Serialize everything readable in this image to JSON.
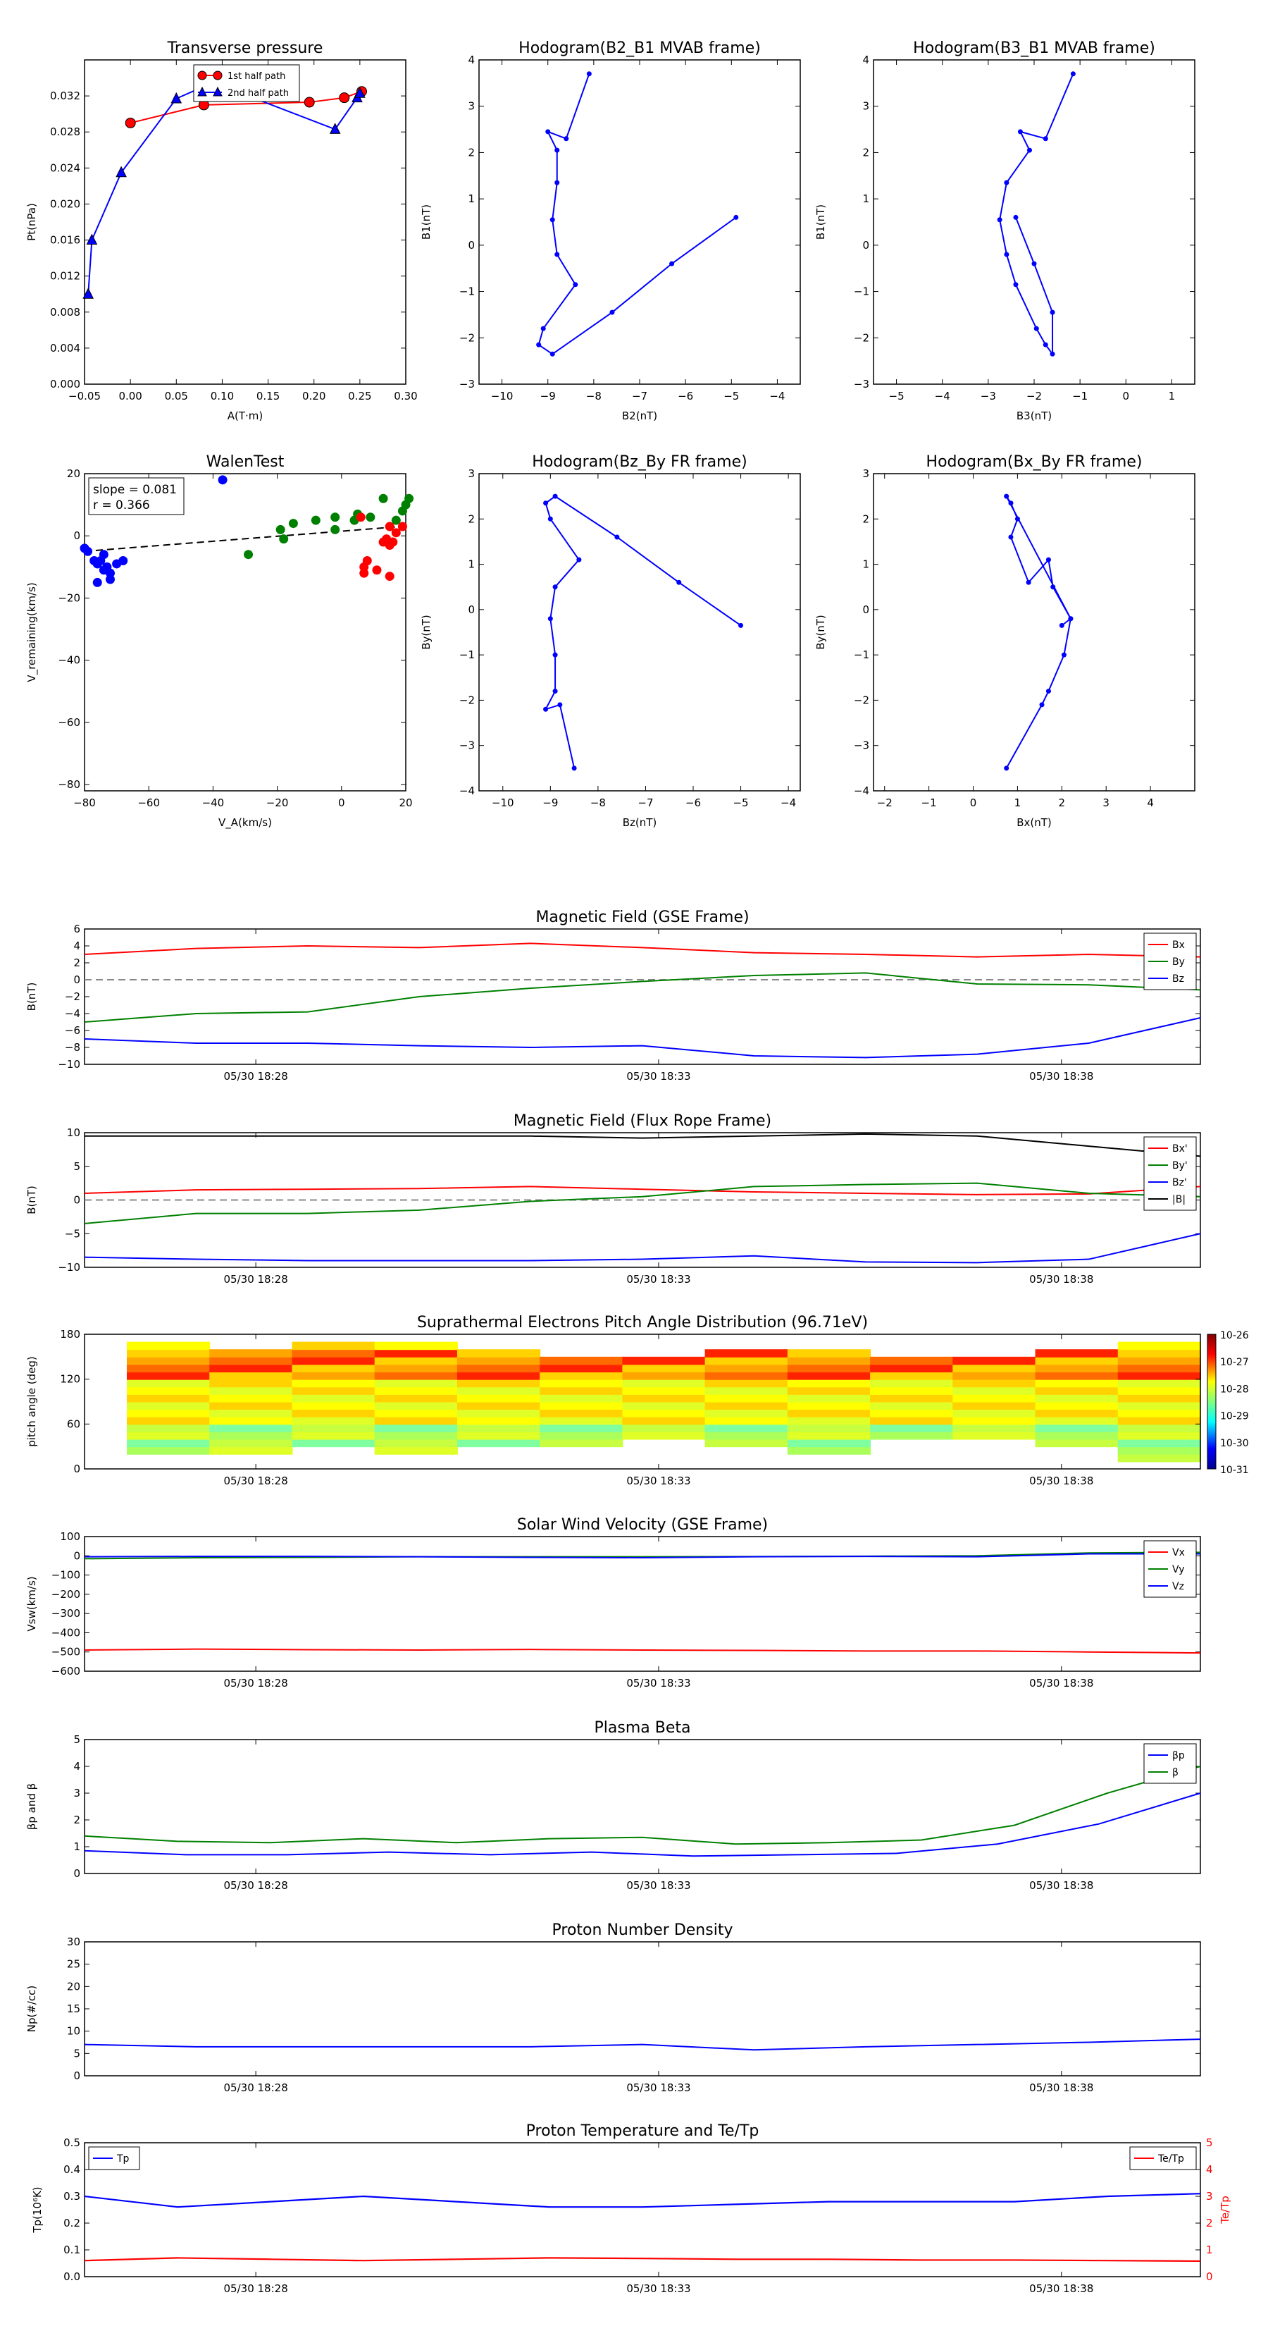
{
  "x_ticks_time": [
    "05/30 18:28",
    "05/30 18:33",
    "05/30 18:38"
  ],
  "chart_data": [
    {
      "id": "transverse-pressure",
      "type": "line",
      "title": "Transverse pressure",
      "xlabel": "A(T·m)",
      "ylabel": "Pt(nPa)",
      "xlim": [
        -0.05,
        0.3
      ],
      "ylim": [
        0.0,
        0.036
      ],
      "xticks": [
        -0.05,
        0.0,
        0.05,
        0.1,
        0.15,
        0.2,
        0.25,
        0.3
      ],
      "xtick_labels": [
        "−0.05",
        "0.00",
        "0.05",
        "0.10",
        "0.15",
        "0.20",
        "0.25",
        "0.30"
      ],
      "yticks": [
        0.0,
        0.004,
        0.008,
        0.012,
        0.016,
        0.02,
        0.024,
        0.028,
        0.032
      ],
      "ytick_labels": [
        "0.000",
        "0.004",
        "0.008",
        "0.012",
        "0.016",
        "0.020",
        "0.024",
        "0.028",
        "0.032"
      ],
      "legend": "top-center",
      "series": [
        {
          "name": "1st half path",
          "color": "#ff0000",
          "marker": "circle",
          "x": [
            0.0,
            0.08,
            0.195,
            0.233,
            0.252
          ],
          "y": [
            0.029,
            0.031,
            0.0313,
            0.0318,
            0.0325
          ]
        },
        {
          "name": "2nd half path",
          "color": "#0000ff",
          "marker": "triangle",
          "x": [
            -0.046,
            -0.042,
            -0.01,
            0.05,
            0.09,
            0.223,
            0.247,
            0.25
          ],
          "y": [
            0.01,
            0.016,
            0.0235,
            0.0317,
            0.0335,
            0.0283,
            0.0318,
            0.0323
          ]
        }
      ]
    },
    {
      "id": "hodogram-b2-b1",
      "type": "line",
      "title": "Hodogram(B2_B1 MVAB frame)",
      "xlabel": "B2(nT)",
      "ylabel": "B1(nT)",
      "xlim": [
        -10.5,
        -3.5
      ],
      "ylim": [
        -3,
        4
      ],
      "xticks": [
        -10,
        -9,
        -8,
        -7,
        -6,
        -5,
        -4
      ],
      "xtick_labels": [
        "−10",
        "−9",
        "−8",
        "−7",
        "−6",
        "−5",
        "−4"
      ],
      "yticks": [
        -3,
        -2,
        -1,
        0,
        1,
        2,
        3,
        4
      ],
      "ytick_labels": [
        "−3",
        "−2",
        "−1",
        "0",
        "1",
        "2",
        "3",
        "4"
      ],
      "series": [
        {
          "color": "#0000ff",
          "x": [
            -4.9,
            -6.3,
            -7.6,
            -8.9,
            -9.2,
            -9.1,
            -8.4,
            -8.8,
            -8.9,
            -8.8,
            -8.8,
            -9.0,
            -8.6,
            -8.1
          ],
          "y": [
            0.6,
            -0.4,
            -1.45,
            -2.35,
            -2.15,
            -1.8,
            -0.85,
            -0.2,
            0.55,
            1.35,
            2.05,
            2.45,
            2.3,
            3.7
          ]
        }
      ]
    },
    {
      "id": "hodogram-b3-b1",
      "type": "line",
      "title": "Hodogram(B3_B1 MVAB frame)",
      "xlabel": "B3(nT)",
      "ylabel": "B1(nT)",
      "xlim": [
        -5.5,
        1.5
      ],
      "ylim": [
        -3,
        4
      ],
      "xticks": [
        -5,
        -4,
        -3,
        -2,
        -1,
        0,
        1
      ],
      "xtick_labels": [
        "−5",
        "−4",
        "−3",
        "−2",
        "−1",
        "0",
        "1"
      ],
      "yticks": [
        -3,
        -2,
        -1,
        0,
        1,
        2,
        3,
        4
      ],
      "ytick_labels": [
        "−3",
        "−2",
        "−1",
        "0",
        "1",
        "2",
        "3",
        "4"
      ],
      "series": [
        {
          "color": "#0000ff",
          "x": [
            -2.4,
            -2.0,
            -1.6,
            -1.6,
            -1.75,
            -1.95,
            -2.4,
            -2.6,
            -2.75,
            -2.6,
            -2.1,
            -2.3,
            -1.75,
            -1.15
          ],
          "y": [
            0.6,
            -0.4,
            -1.45,
            -2.35,
            -2.15,
            -1.8,
            -0.85,
            -0.2,
            0.55,
            1.35,
            2.05,
            2.45,
            2.3,
            3.7
          ]
        }
      ]
    },
    {
      "id": "walen-test",
      "type": "scatter",
      "title": "WalenTest",
      "xlabel": "V_A(km/s)",
      "ylabel": "V_remaining(km/s)",
      "xlim": [
        -80,
        20
      ],
      "ylim": [
        -82,
        20
      ],
      "xticks": [
        -80,
        -60,
        -40,
        -20,
        0,
        20
      ],
      "xtick_labels": [
        "−80",
        "−60",
        "−40",
        "−20",
        "0",
        "20"
      ],
      "yticks": [
        -80,
        -60,
        -40,
        -20,
        0,
        20
      ],
      "ytick_labels": [
        "−80",
        "−60",
        "−40",
        "−20",
        "0",
        "20"
      ],
      "annotation": [
        "slope = 0.081",
        "r = 0.366"
      ],
      "fit": {
        "slope": 0.081,
        "intercept": 1.5,
        "color": "#000000",
        "style": "dashed"
      },
      "series": [
        {
          "color": "#0000ff",
          "x": [
            -80,
            -79,
            -76,
            -75,
            -74,
            -73,
            -72,
            -70,
            -68,
            -76,
            -74,
            -72,
            -77,
            -37
          ],
          "y": [
            -4,
            -5,
            -9,
            -8,
            -6,
            -10,
            -12,
            -9,
            -8,
            -15,
            -11,
            -14,
            -8,
            18
          ]
        },
        {
          "color": "#008000",
          "x": [
            -29,
            -19,
            -18,
            -15,
            -8,
            -2,
            -2,
            4,
            5,
            9,
            13,
            17,
            19,
            20,
            21
          ],
          "y": [
            -6,
            2,
            -1,
            4,
            5,
            6,
            2,
            5,
            7,
            6,
            12,
            5,
            8,
            10,
            12
          ]
        },
        {
          "color": "#ff0000",
          "x": [
            6,
            7,
            7,
            8,
            11,
            13,
            14,
            15,
            15,
            16,
            17,
            19,
            15
          ],
          "y": [
            6,
            -12,
            -10,
            -8,
            -11,
            -2,
            -1,
            3,
            -3,
            -2,
            1,
            3,
            -13
          ]
        }
      ]
    },
    {
      "id": "hodogram-bz-by",
      "type": "line",
      "title": "Hodogram(Bz_By FR frame)",
      "xlabel": "Bz(nT)",
      "ylabel": "By(nT)",
      "xlim": [
        -10.5,
        -3.75
      ],
      "ylim": [
        -4,
        3
      ],
      "xticks": [
        -10,
        -9,
        -8,
        -7,
        -6,
        -5,
        -4
      ],
      "xtick_labels": [
        "−10",
        "−9",
        "−8",
        "−7",
        "−6",
        "−5",
        "−4"
      ],
      "yticks": [
        -4,
        -3,
        -2,
        -1,
        0,
        1,
        2,
        3
      ],
      "ytick_labels": [
        "−4",
        "−3",
        "−2",
        "−1",
        "0",
        "1",
        "2",
        "3"
      ],
      "series": [
        {
          "color": "#0000ff",
          "x": [
            -5.0,
            -6.3,
            -7.6,
            -8.9,
            -9.1,
            -9.0,
            -8.4,
            -8.9,
            -9.0,
            -8.9,
            -8.9,
            -9.1,
            -8.8,
            -8.5
          ],
          "y": [
            -0.35,
            0.6,
            1.6,
            2.5,
            2.35,
            2.0,
            1.1,
            0.5,
            -0.2,
            -1.0,
            -1.8,
            -2.2,
            -2.1,
            -3.5
          ]
        }
      ]
    },
    {
      "id": "hodogram-bx-by",
      "type": "line",
      "title": "Hodogram(Bx_By FR frame)",
      "xlabel": "Bx(nT)",
      "ylabel": "By(nT)",
      "xlim": [
        -2.25,
        5.0
      ],
      "ylim": [
        -4,
        3
      ],
      "xticks": [
        -2,
        -1,
        0,
        1,
        2,
        3,
        4
      ],
      "xtick_labels": [
        "−2",
        "−1",
        "0",
        "1",
        "2",
        "3",
        "4"
      ],
      "yticks": [
        -4,
        -3,
        -2,
        -1,
        0,
        1,
        2,
        3
      ],
      "ytick_labels": [
        "−4",
        "−3",
        "−2",
        "−1",
        "0",
        "1",
        "2",
        "3"
      ],
      "series": [
        {
          "color": "#0000ff",
          "x": [
            2.0,
            2.2,
            1.8,
            1.7,
            1.25,
            0.85,
            1.0,
            0.85,
            0.75,
            2.2,
            2.05,
            1.7,
            1.55,
            0.75
          ],
          "y": [
            -0.35,
            -0.2,
            0.5,
            1.1,
            0.6,
            1.6,
            2.0,
            2.35,
            2.5,
            -0.2,
            -1.0,
            -1.8,
            -2.1,
            -3.5
          ]
        }
      ]
    },
    {
      "id": "magnetic-field-gse",
      "type": "line",
      "title": "Magnetic Field (GSE Frame)",
      "ylabel": "B(nT)",
      "ylim": [
        -10,
        6
      ],
      "yticks": [
        -10,
        -8,
        -6,
        -4,
        -2,
        0,
        2,
        4,
        6
      ],
      "ytick_labels": [
        "−10",
        "−8",
        "−6",
        "−4",
        "−2",
        "0",
        "2",
        "4",
        "6"
      ],
      "zero_line": true,
      "legend": "top-right",
      "series": [
        {
          "name": "Bx",
          "color": "#ff0000",
          "values": [
            3.0,
            3.7,
            4.0,
            3.8,
            4.3,
            3.8,
            3.2,
            3.0,
            2.7,
            3.0,
            2.7
          ]
        },
        {
          "name": "By",
          "color": "#008000",
          "values": [
            -5.0,
            -4.0,
            -3.8,
            -2.0,
            -1.0,
            -0.2,
            0.5,
            0.8,
            -0.5,
            -0.6,
            -1.2
          ]
        },
        {
          "name": "Bz",
          "color": "#0000ff",
          "values": [
            -7.0,
            -7.5,
            -7.5,
            -7.8,
            -8.0,
            -7.8,
            -9.0,
            -9.2,
            -8.8,
            -7.5,
            -4.5
          ]
        }
      ]
    },
    {
      "id": "magnetic-field-fr",
      "type": "line",
      "title": "Magnetic Field (Flux Rope Frame)",
      "ylabel": "B(nT)",
      "ylim": [
        -10,
        10
      ],
      "yticks": [
        -10,
        -5,
        0,
        5,
        10
      ],
      "ytick_labels": [
        "−10",
        "−5",
        "0",
        "5",
        "10"
      ],
      "zero_line": true,
      "legend": "top-right",
      "series": [
        {
          "name": "Bx'",
          "color": "#ff0000",
          "values": [
            1.0,
            1.5,
            1.6,
            1.7,
            2.0,
            1.6,
            1.2,
            1.0,
            0.8,
            0.9,
            2.0
          ]
        },
        {
          "name": "By'",
          "color": "#008000",
          "values": [
            -3.5,
            -2.0,
            -2.0,
            -1.5,
            -0.2,
            0.5,
            2.0,
            2.3,
            2.5,
            1.0,
            0.5
          ]
        },
        {
          "name": "Bz'",
          "color": "#0000ff",
          "values": [
            -8.5,
            -8.8,
            -9.0,
            -9.0,
            -9.0,
            -8.8,
            -8.3,
            -9.2,
            -9.3,
            -8.8,
            -5.0
          ]
        },
        {
          "name": "|B|",
          "color": "#000000",
          "values": [
            9.5,
            9.5,
            9.5,
            9.5,
            9.5,
            9.2,
            9.5,
            9.8,
            9.5,
            8.0,
            6.5
          ]
        }
      ]
    },
    {
      "id": "pitch-angle-distribution",
      "type": "heatmap",
      "title": "Suprathermal Electrons Pitch Angle Distribution (96.71eV)",
      "ylabel": "pitch angle (deg)",
      "ylim": [
        0,
        180
      ],
      "yticks": [
        0,
        60,
        120,
        180
      ],
      "ytick_labels": [
        "0",
        "60",
        "120",
        "180"
      ],
      "colorbar": {
        "labels": [
          "10-26",
          "10-27",
          "10-28",
          "10-29",
          "10-30",
          "10-31"
        ]
      },
      "columns": 13,
      "bins": 18
    },
    {
      "id": "solar-wind-velocity",
      "type": "line",
      "title": "Solar Wind Velocity (GSE Frame)",
      "ylabel": "Vsw(km/s)",
      "ylim": [
        -600,
        100
      ],
      "yticks": [
        -600,
        -500,
        -400,
        -300,
        -200,
        -100,
        0,
        100
      ],
      "ytick_labels": [
        "−600",
        "−500",
        "−400",
        "−300",
        "−200",
        "−100",
        "0",
        "100"
      ],
      "legend": "top-right",
      "series": [
        {
          "name": "Vx",
          "color": "#ff0000",
          "values": [
            -490,
            -485,
            -488,
            -490,
            -487,
            -490,
            -492,
            -495,
            -495,
            -500,
            -505
          ]
        },
        {
          "name": "Vy",
          "color": "#008000",
          "values": [
            -15,
            -10,
            -8,
            -5,
            -5,
            -5,
            -4,
            -2,
            0,
            15,
            18
          ]
        },
        {
          "name": "Vz",
          "color": "#0000ff",
          "values": [
            -5,
            -3,
            -3,
            -5,
            -8,
            -10,
            -5,
            -3,
            -5,
            10,
            10
          ]
        }
      ]
    },
    {
      "id": "plasma-beta",
      "type": "line",
      "title": "Plasma Beta",
      "ylabel": "βp and β",
      "ylim": [
        0,
        5
      ],
      "yticks": [
        0,
        1,
        2,
        3,
        4,
        5
      ],
      "ytick_labels": [
        "0",
        "1",
        "2",
        "3",
        "4",
        "5"
      ],
      "legend": "top-right",
      "series": [
        {
          "name": "βp",
          "color": "#0000ff",
          "values": [
            0.85,
            0.7,
            0.7,
            0.8,
            0.7,
            0.8,
            0.65,
            0.7,
            0.75,
            1.1,
            1.85,
            3.0
          ]
        },
        {
          "name": "β",
          "color": "#008000",
          "values": [
            1.4,
            1.2,
            1.15,
            1.3,
            1.15,
            1.3,
            1.35,
            1.1,
            1.15,
            1.25,
            1.8,
            3.0,
            4.0
          ]
        }
      ]
    },
    {
      "id": "proton-number-density",
      "type": "line",
      "title": "Proton Number Density",
      "ylabel": "Np(#/cc)",
      "ylim": [
        0,
        30
      ],
      "yticks": [
        0,
        5,
        10,
        15,
        20,
        25,
        30
      ],
      "ytick_labels": [
        "0",
        "5",
        "10",
        "15",
        "20",
        "25",
        "30"
      ],
      "series": [
        {
          "color": "#0000ff",
          "values": [
            7.0,
            6.5,
            6.5,
            6.5,
            6.5,
            7.0,
            5.8,
            6.5,
            7.0,
            7.5,
            8.2
          ]
        }
      ]
    },
    {
      "id": "proton-temperature",
      "type": "line",
      "title": "Proton Temperature and Te/Tp",
      "ylabel": "Tp(10⁶K)",
      "ylabel_right": "Te/Tp",
      "ylim": [
        0,
        0.5
      ],
      "yticks": [
        0,
        0.1,
        0.2,
        0.3,
        0.4,
        0.5
      ],
      "ytick_labels": [
        "0.0",
        "0.1",
        "0.2",
        "0.3",
        "0.4",
        "0.5"
      ],
      "ylim_right": [
        0,
        5
      ],
      "yticks_right": [
        0,
        1,
        2,
        3,
        4,
        5
      ],
      "ytick_labels_right": [
        "0",
        "1",
        "2",
        "3",
        "4",
        "5"
      ],
      "legend_left": "top-left",
      "legend_right": "top-right",
      "series": [
        {
          "name": "Tp",
          "color": "#0000ff",
          "axis": "left",
          "values": [
            0.3,
            0.26,
            0.28,
            0.3,
            0.28,
            0.26,
            0.26,
            0.27,
            0.28,
            0.28,
            0.28,
            0.3,
            0.31
          ]
        },
        {
          "name": "Te/Tp",
          "color": "#ff0000",
          "axis": "right",
          "values": [
            0.6,
            0.7,
            0.65,
            0.6,
            0.65,
            0.7,
            0.68,
            0.65,
            0.65,
            0.62,
            0.62,
            0.6,
            0.58
          ]
        }
      ]
    }
  ]
}
